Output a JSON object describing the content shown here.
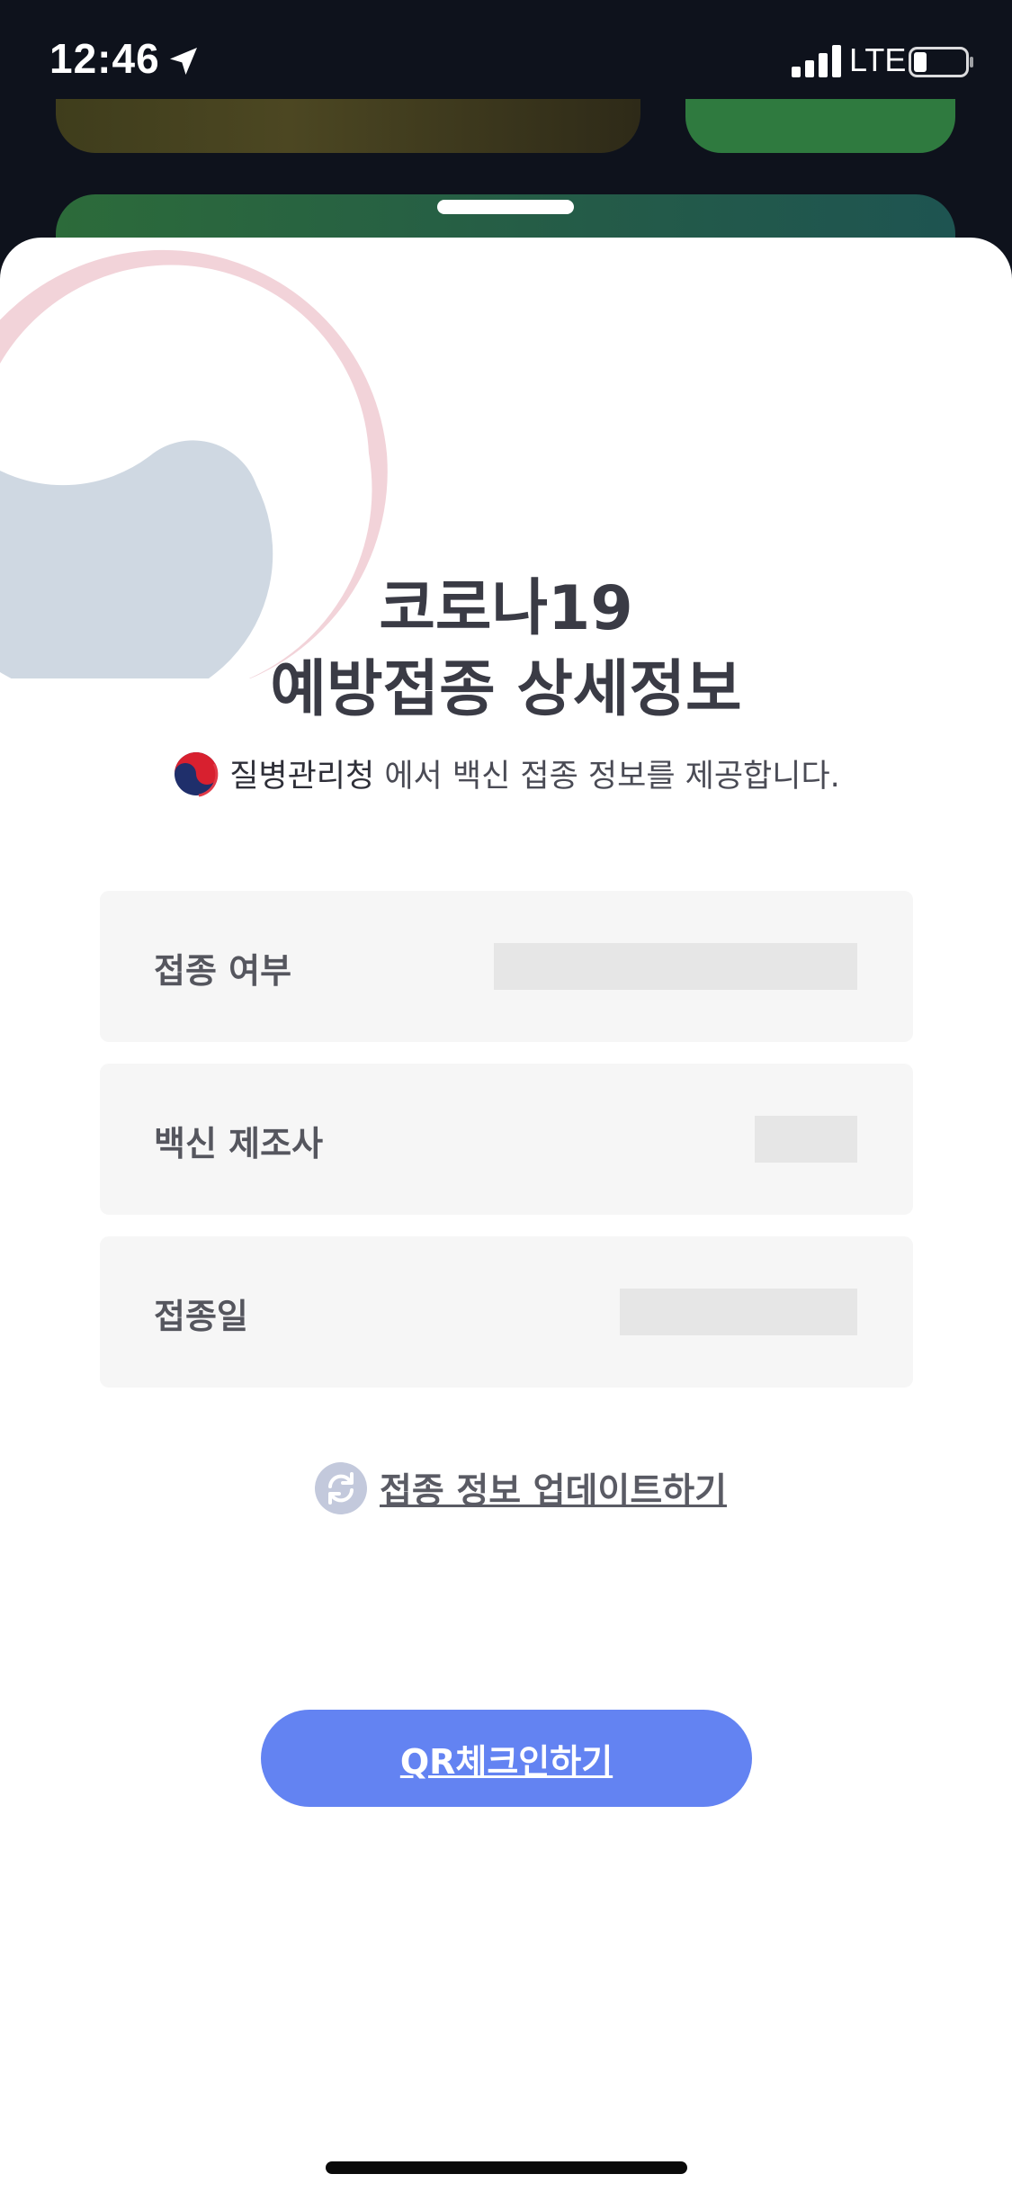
{
  "status_bar": {
    "time": "12:46",
    "network": "LTE",
    "icons": [
      "location-arrow-icon",
      "cellular-signal-icon",
      "battery-icon"
    ]
  },
  "sheet": {
    "title_line1": "코로나19",
    "title_line2": "예방접종 상세정보",
    "provider_name": "질병관리청",
    "provider_suffix": " 에서 백신 접종 정보를 제공합니다.",
    "rows": [
      {
        "label": "접종 여부",
        "value_redacted": true
      },
      {
        "label": "백신 제조사",
        "value_redacted": true
      },
      {
        "label": "접종일",
        "value_redacted": true
      }
    ],
    "update_label": "접종 정보 업데이트하기",
    "qr_button_label": "QR체크인하기"
  },
  "colors": {
    "accent": "#6383f2",
    "title": "#3a3b45",
    "row_bg": "#f6f6f6",
    "redacted": "#e6e6e6",
    "emblem_red": "#f2d3d9",
    "emblem_blue": "#cfd8e2"
  }
}
